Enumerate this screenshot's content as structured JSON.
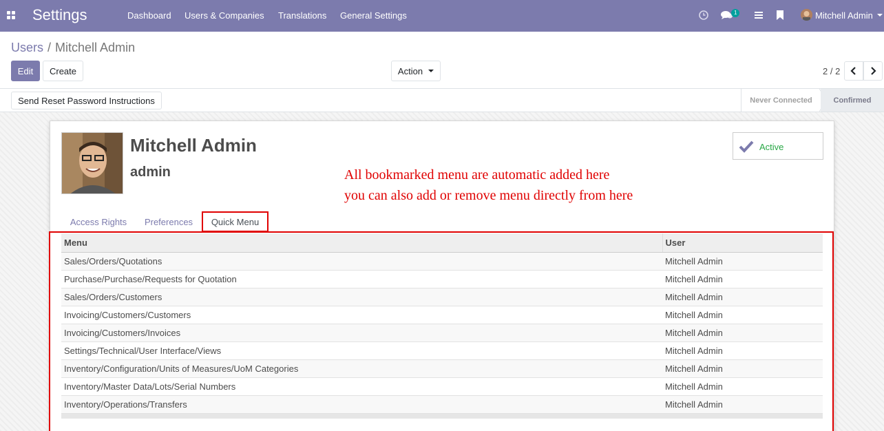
{
  "navbar": {
    "app_title": "Settings",
    "menu": [
      "Dashboard",
      "Users & Companies",
      "Translations",
      "General Settings"
    ],
    "messages_badge": "1",
    "user_name": "Mitchell Admin",
    "brand_color": "#7c7bad"
  },
  "breadcrumb": {
    "parent": "Users",
    "separator": "/",
    "current": "Mitchell Admin"
  },
  "toolbar": {
    "edit_label": "Edit",
    "create_label": "Create",
    "action_label": "Action"
  },
  "pager": {
    "value": "2 / 2"
  },
  "statusbar": {
    "reset_password_label": "Send Reset Password Instructions",
    "stages": [
      "Never Connected",
      "Confirmed"
    ],
    "current_stage": "Confirmed"
  },
  "record": {
    "name": "Mitchell Admin",
    "login": "admin",
    "active_label": "Active"
  },
  "annotation": {
    "line1": "All bookmarked menu are automatic added here",
    "line2": "you can also add or remove menu directly from here",
    "color": "#e00000"
  },
  "tabs": [
    "Access Rights",
    "Preferences",
    "Quick Menu"
  ],
  "active_tab": "Quick Menu",
  "quick_menu": {
    "columns": [
      "Menu",
      "User"
    ],
    "rows": [
      [
        "Sales/Orders/Quotations",
        "Mitchell Admin"
      ],
      [
        "Purchase/Purchase/Requests for Quotation",
        "Mitchell Admin"
      ],
      [
        "Sales/Orders/Customers",
        "Mitchell Admin"
      ],
      [
        "Invoicing/Customers/Customers",
        "Mitchell Admin"
      ],
      [
        "Invoicing/Customers/Invoices",
        "Mitchell Admin"
      ],
      [
        "Settings/Technical/User Interface/Views",
        "Mitchell Admin"
      ],
      [
        "Inventory/Configuration/Units of Measures/UoM Categories",
        "Mitchell Admin"
      ],
      [
        "Inventory/Master Data/Lots/Serial Numbers",
        "Mitchell Admin"
      ],
      [
        "Inventory/Operations/Transfers",
        "Mitchell Admin"
      ]
    ]
  }
}
